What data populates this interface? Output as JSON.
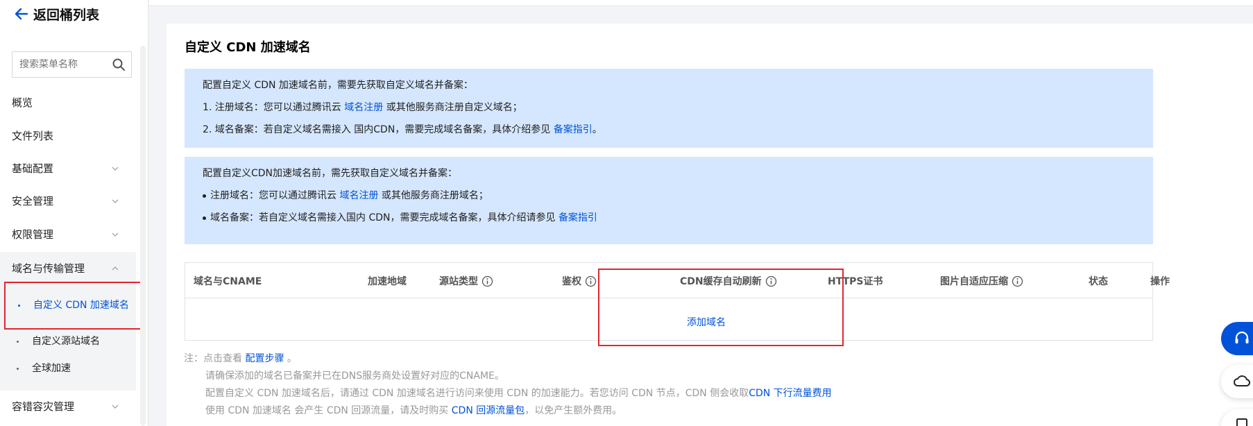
{
  "sidebar": {
    "back_label": "返回桶列表",
    "search_placeholder": "搜索菜单名称",
    "items": [
      {
        "label": "概览"
      },
      {
        "label": "文件列表"
      },
      {
        "label": "基础配置"
      },
      {
        "label": "安全管理"
      },
      {
        "label": "权限管理"
      },
      {
        "label": "域名与传输管理"
      },
      {
        "label": "容错容灾管理"
      }
    ],
    "sub_items": [
      {
        "label": "自定义 CDN 加速域名"
      },
      {
        "label": "自定义源站域名"
      },
      {
        "label": "全球加速"
      }
    ]
  },
  "main": {
    "title": "自定义 CDN 加速域名",
    "notice1": {
      "intro": "配置自定义 CDN 加速域名前，需要先获取自定义域名并备案：",
      "line1_pre": "1. 注册域名：您可以通过腾讯云 ",
      "line1_link": "域名注册",
      "line1_post": " 或其他服务商注册自定义域名；",
      "line2_pre": "2. 域名备案：若自定义域名需接入 国内CDN，需要完成域名备案，具体介绍参见 ",
      "line2_link": "备案指引",
      "line2_post": "。"
    },
    "notice2": {
      "intro": "配置自定义CDN加速域名前，需先获取自定义域名并备案：",
      "line1_pre": "注册域名：您可以通过腾讯云 ",
      "line1_link": "域名注册",
      "line1_post": " 或其他服务商注册域名；",
      "line2_pre": "域名备案：若自定义域名需接入国内 CDN，需要完成域名备案，具体介绍请参见 ",
      "line2_link": "备案指引"
    },
    "table": {
      "columns": [
        "域名与CNAME",
        "加速地域",
        "源站类型",
        "鉴权",
        "CDN缓存自动刷新",
        "HTTPS证书",
        "图片自适应压缩",
        "状态",
        "操作"
      ],
      "add_label": "添加域名"
    },
    "notes": {
      "prefix": "注：点击查看 ",
      "link": "配置步骤",
      "suffix": " 。",
      "line2": "请确保添加的域名已备案并已在DNS服务商处设置好对应的CNAME。",
      "line3_pre": "配置自定义 CDN 加速域名后，请通过 CDN 加速域名进行访问来使用 CDN 的加速能力。若您访问 CDN 节点，CDN 侧会收取",
      "line3_link": "CDN 下行流量费用",
      "line4_pre": "使用 CDN 加速域名 会产生 CDN 回源流量，请及时购买 ",
      "line4_link": "CDN 回源流量包",
      "line4_post": "，以免产生额外费用。"
    }
  },
  "colors": {
    "accent": "#0052d9",
    "notice_bg": "#d5e7fe",
    "highlight": "#e0262f"
  }
}
